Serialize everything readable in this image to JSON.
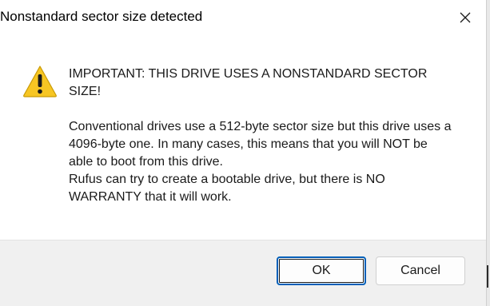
{
  "window": {
    "title": "Nonstandard sector size detected",
    "close_icon": "close-icon"
  },
  "message": {
    "icon": "warning-icon",
    "heading": "IMPORTANT: THIS DRIVE USES A NONSTANDARD SECTOR SIZE!",
    "body_line1": "Conventional drives use a 512-byte sector size but this drive uses a 4096-byte one. In many cases, this means that you will NOT be able to boot from this drive.",
    "body_line2": "Rufus can try to create a bootable drive, but there is NO WARRANTY that it will work."
  },
  "buttons": {
    "ok_label": "OK",
    "cancel_label": "Cancel"
  },
  "colors": {
    "accent": "#005fb8",
    "warning_fill": "#f7c623",
    "footer_bg": "#f0f0f0"
  }
}
